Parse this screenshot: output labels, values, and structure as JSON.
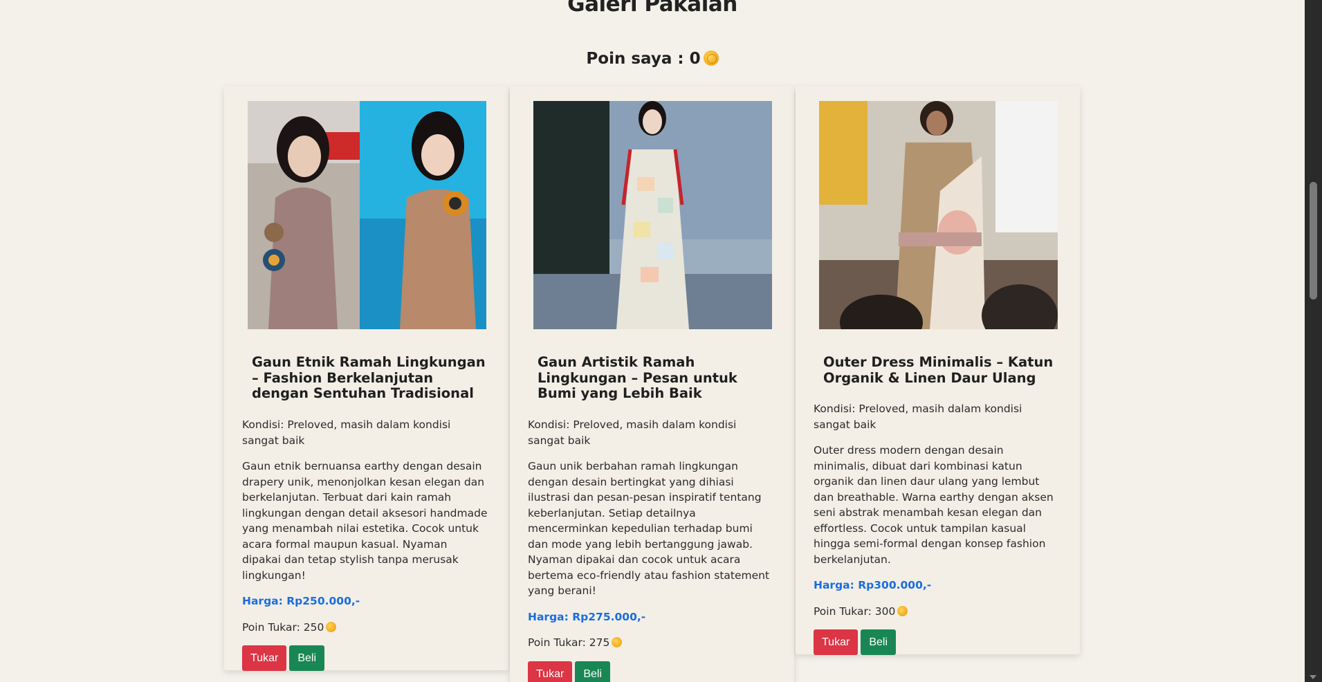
{
  "page": {
    "title": "Galeri Pakaian",
    "points_label": "Poin saya : 0"
  },
  "colors": {
    "background": "#f4f1ea",
    "price": "#1a6de0",
    "exchange_button": "#dc3545",
    "buy_button": "#198754"
  },
  "products": [
    {
      "title": "Gaun Etnik Ramah Lingkungan – Fashion Berkelanjutan dengan Sentuhan Tradisional",
      "condition": "Kondisi: Preloved, masih dalam kondisi sangat baik",
      "description": "Gaun etnik bernuansa earthy dengan desain drapery unik, menonjolkan kesan elegan dan berkelanjutan. Terbuat dari kain ramah lingkungan dengan detail aksesori handmade yang menambah nilai estetika. Cocok untuk acara formal maupun kasual. Nyaman dipakai dan tetap stylish tanpa merusak lingkungan!",
      "price": "Harga: Rp250.000,-",
      "exchange_points": "Poin Tukar: 250",
      "exchange_label": "Tukar",
      "buy_label": "Beli"
    },
    {
      "title": "Gaun Artistik Ramah Lingkungan – Pesan untuk Bumi yang Lebih Baik",
      "condition": "Kondisi: Preloved, masih dalam kondisi sangat baik",
      "description": "Gaun unik berbahan ramah lingkungan dengan desain bertingkat yang dihiasi ilustrasi dan pesan-pesan inspiratif tentang keberlanjutan. Setiap detailnya mencerminkan kepedulian terhadap bumi dan mode yang lebih bertanggung jawab. Nyaman dipakai dan cocok untuk acara bertema eco-friendly atau fashion statement yang berani!",
      "price": "Harga: Rp275.000,-",
      "exchange_points": "Poin Tukar: 275",
      "exchange_label": "Tukar",
      "buy_label": "Beli"
    },
    {
      "title": "Outer Dress Minimalis – Katun Organik & Linen Daur Ulang",
      "condition": "Kondisi: Preloved, masih dalam kondisi sangat baik",
      "description": "Outer dress modern dengan desain minimalis, dibuat dari kombinasi katun organik dan linen daur ulang yang lembut dan breathable. Warna earthy dengan aksen seni abstrak menambah kesan elegan dan effortless. Cocok untuk tampilan kasual hingga semi-formal dengan konsep fashion berkelanjutan.",
      "price": "Harga: Rp300.000,-",
      "exchange_points": "Poin Tukar: 300",
      "exchange_label": "Tukar",
      "buy_label": "Beli"
    }
  ]
}
